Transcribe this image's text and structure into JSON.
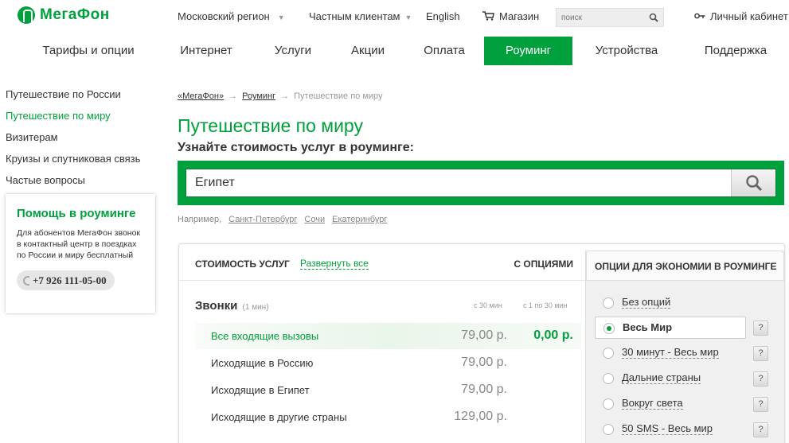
{
  "brand": {
    "name": "МегаФон",
    "color": "#00a03c"
  },
  "topbar": {
    "region": "Московский регион",
    "segment": "Частным клиентам",
    "language": "English",
    "shop": "Магазин",
    "search_placeholder": "поиск",
    "account": "Личный кабинет"
  },
  "nav": {
    "items": [
      {
        "label": "Тарифы и опции"
      },
      {
        "label": "Интернет"
      },
      {
        "label": "Услуги"
      },
      {
        "label": "Акции"
      },
      {
        "label": "Оплата"
      },
      {
        "label": "Роуминг",
        "active": true
      },
      {
        "label": "Устройства"
      },
      {
        "label": "Поддержка"
      }
    ]
  },
  "sidebar": {
    "items": [
      {
        "label": "Путешествие по России"
      },
      {
        "label": "Путешествие по миру",
        "active": true
      },
      {
        "label": "Визитерам"
      },
      {
        "label": "Круизы и спутниковая связь"
      },
      {
        "label": "Частые вопросы"
      }
    ],
    "help": {
      "title": "Помощь в роуминге",
      "text": "Для абонентов МегаФон звонок в контактный центр в поездках по России и миру бесплатный",
      "phone": "+7 926 111-05-00"
    }
  },
  "breadcrumb": {
    "items": [
      "«МегаФон»",
      "Роуминг",
      "Путешествие по миру"
    ],
    "separator": "→"
  },
  "page": {
    "title": "Путешествие по миру",
    "subtitle": "Узнайте стоимость услуг в роуминге:"
  },
  "search": {
    "value": "Египет",
    "examples_label": "Например,",
    "examples": [
      "Санкт-Петербург",
      "Сочи",
      "Екатеринбург"
    ]
  },
  "pricing": {
    "header": {
      "services": "СТОИМОСТЬ УСЛУГ",
      "expand_all": "Развернуть все",
      "with_options": "С ОПЦИЯМИ"
    },
    "section": {
      "title": "Звонки",
      "unit": "(1 мин)",
      "col1": "с 30 мин",
      "col2": "с 1 по 30 мин"
    },
    "rows": [
      {
        "label": "Все входящие вызовы",
        "price": "79,00 р.",
        "option_price": "0,00 р.",
        "highlight": true
      },
      {
        "label": "Исходящие в Россию",
        "price": "79,00 р."
      },
      {
        "label": "Исходящие в Египет",
        "price": "79,00 р."
      },
      {
        "label": "Исходящие в другие страны",
        "price": "129,00 р."
      }
    ],
    "options": {
      "title": "ОПЦИИ ДЛЯ ЭКОНОМИИ В РОУМИНГЕ",
      "items": [
        {
          "label": "Без опций",
          "selected": false,
          "help": false
        },
        {
          "label": "Весь Мир",
          "selected": true,
          "help": true
        },
        {
          "label": "30 минут - Весь мир",
          "selected": false,
          "help": true
        },
        {
          "label": "Дальние страны",
          "selected": false,
          "help": true
        },
        {
          "label": "Вокруг света",
          "selected": false,
          "help": true
        },
        {
          "label": "50 SMS - Весь мир",
          "selected": false,
          "help": true
        }
      ],
      "help_label": "?"
    }
  }
}
